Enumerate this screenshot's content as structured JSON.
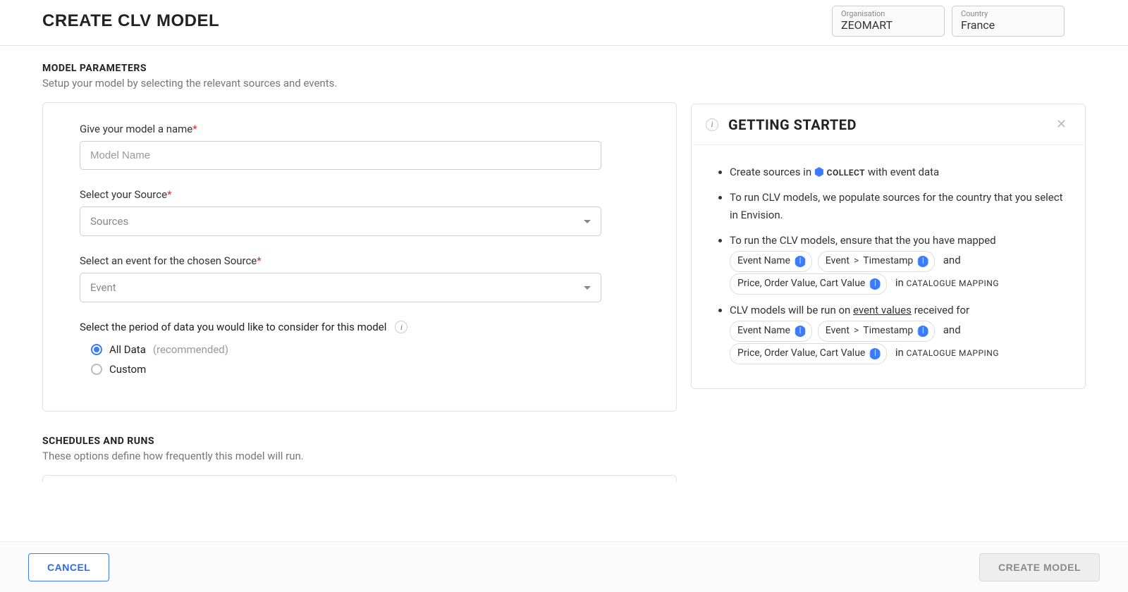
{
  "header": {
    "title": "CREATE CLV MODEL",
    "org_label": "Organisation",
    "org_value": "ZEOMART",
    "country_label": "Country",
    "country_value": "France"
  },
  "sections": {
    "params_heading": "MODEL PARAMETERS",
    "params_sub": "Setup your model by selecting the relevant sources and events.",
    "schedule_heading": "SCHEDULES AND RUNS",
    "schedule_sub": "These options define how frequently this model will run."
  },
  "form": {
    "name_label": "Give your model a name",
    "name_placeholder": "Model Name",
    "source_label": "Select your Source",
    "source_placeholder": "Sources",
    "event_label": "Select an event for the chosen Source",
    "event_placeholder": "Event",
    "period_label": "Select the period of data you would like to consider for this model",
    "period_all": "All Data",
    "period_all_rec": "(recommended)",
    "period_custom": "Custom"
  },
  "panel": {
    "title": "GETTING STARTED",
    "li1_a": "Create sources in",
    "li1_b": "COLLECT",
    "li1_c": "with event data",
    "li2": "To run CLV models, we populate sources for the country that you select in Envision.",
    "li3": "To run the CLV models, ensure that the you have mapped",
    "li4_a": "CLV models will be run on",
    "li4_b": "event values",
    "li4_c": "received for",
    "pill_event_name": "Event Name",
    "pill_event": "Event",
    "pill_timestamp": "Timestamp",
    "pill_price": "Price, Order Value, Cart Value",
    "and": "and",
    "in": "in",
    "cat_map": "CATALOGUE MAPPING",
    "sep": ">"
  },
  "footer": {
    "cancel": "CANCEL",
    "create": "CREATE MODEL"
  }
}
